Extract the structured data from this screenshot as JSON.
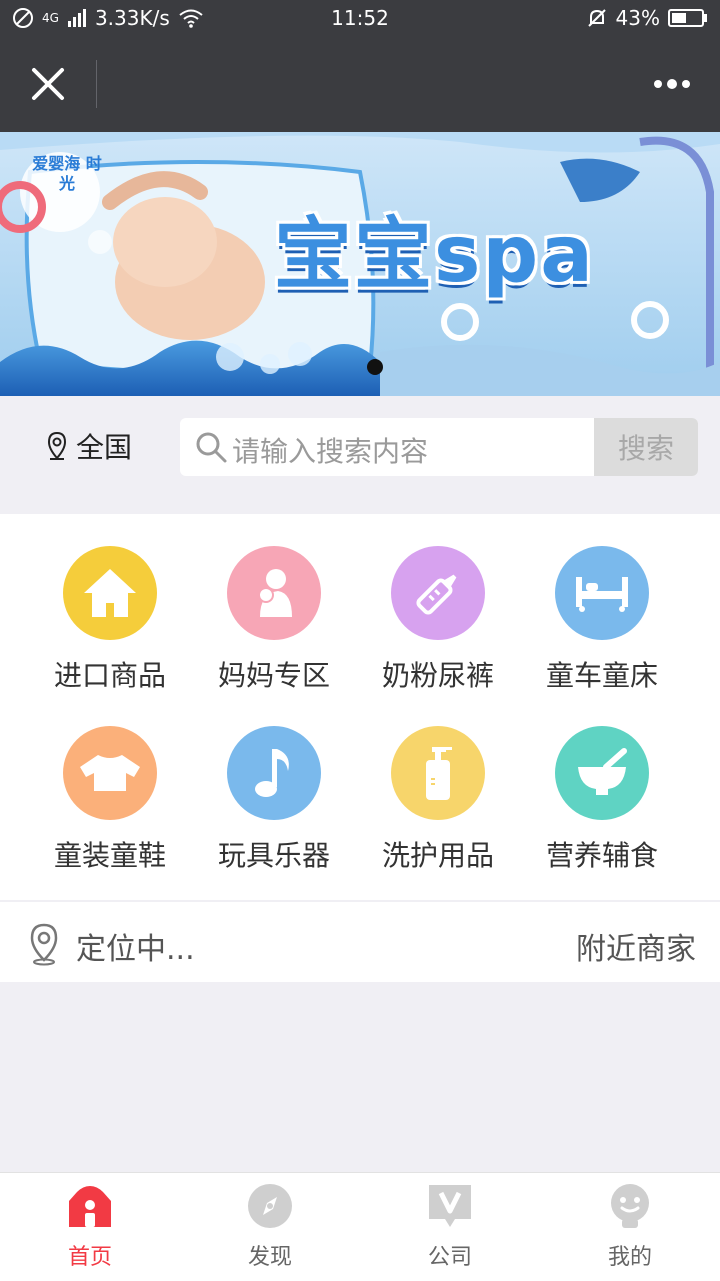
{
  "status": {
    "network": "4G",
    "speed": "3.33K/s",
    "time": "11:52",
    "battery": "43%"
  },
  "banner": {
    "logo": "爱婴海 时光",
    "headline": "宝宝spa"
  },
  "search": {
    "location": "全国",
    "placeholder": "请输入搜索内容",
    "button": "搜索"
  },
  "categories": [
    {
      "label": "进口商品",
      "icon": "house-icon",
      "color": "#f5cd3b"
    },
    {
      "label": "妈妈专区",
      "icon": "mother-baby-icon",
      "color": "#f7a6b6"
    },
    {
      "label": "奶粉尿裤",
      "icon": "baby-bottle-icon",
      "color": "#d7a2ef"
    },
    {
      "label": "童车童床",
      "icon": "crib-icon",
      "color": "#7ab9ec"
    },
    {
      "label": "童装童鞋",
      "icon": "clothes-icon",
      "color": "#fbb07a"
    },
    {
      "label": "玩具乐器",
      "icon": "music-note-icon",
      "color": "#7ab9ec"
    },
    {
      "label": "洗护用品",
      "icon": "lotion-bottle-icon",
      "color": "#f7d56b"
    },
    {
      "label": "营养辅食",
      "icon": "mortar-icon",
      "color": "#5fd3c3"
    }
  ],
  "nearby": {
    "locating": "定位中...",
    "link": "附近商家"
  },
  "tabs": [
    {
      "label": "首页",
      "active": true
    },
    {
      "label": "发现",
      "active": false
    },
    {
      "label": "公司",
      "active": false
    },
    {
      "label": "我的",
      "active": false
    }
  ],
  "colors": {
    "accent": "#f23a44",
    "bar": "#3b3c40"
  }
}
